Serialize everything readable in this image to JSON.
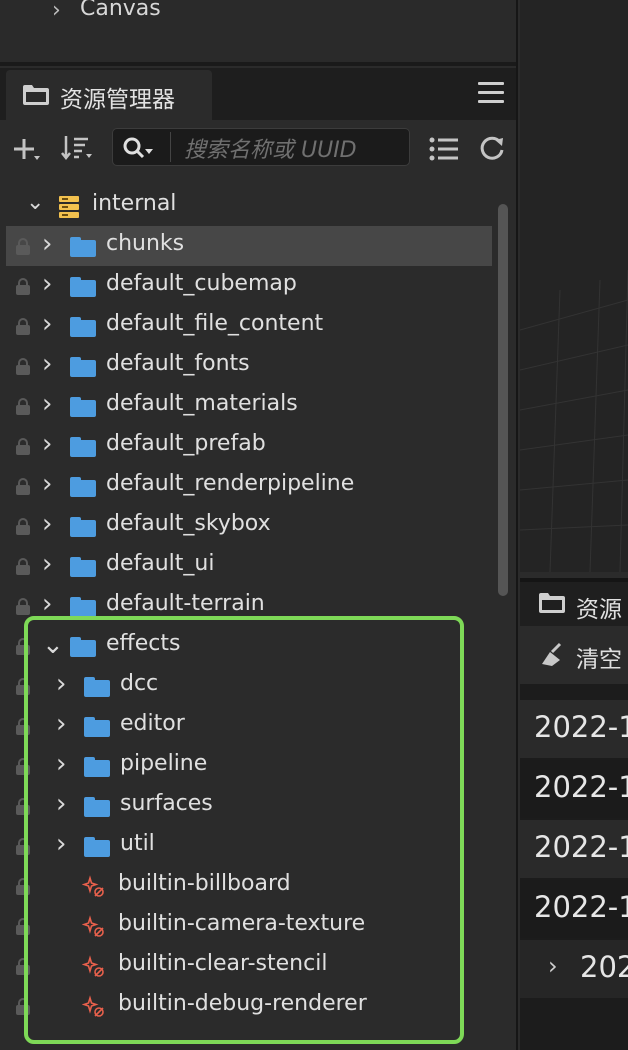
{
  "top_node": {
    "label": "Canvas"
  },
  "assets_panel": {
    "tab_label": "资源管理器",
    "search_placeholder": "搜索名称或 UUID"
  },
  "tree": {
    "root": {
      "label": "internal"
    },
    "items": [
      {
        "label": "chunks",
        "selected": true
      },
      {
        "label": "default_cubemap"
      },
      {
        "label": "default_file_content"
      },
      {
        "label": "default_fonts"
      },
      {
        "label": "default_materials"
      },
      {
        "label": "default_prefab"
      },
      {
        "label": "default_renderpipeline"
      },
      {
        "label": "default_skybox"
      },
      {
        "label": "default_ui"
      },
      {
        "label": "default-terrain"
      },
      {
        "label": "effects",
        "expanded": true
      }
    ],
    "effects_children": [
      {
        "label": "dcc",
        "type": "folder"
      },
      {
        "label": "editor",
        "type": "folder"
      },
      {
        "label": "pipeline",
        "type": "folder"
      },
      {
        "label": "surfaces",
        "type": "folder"
      },
      {
        "label": "util",
        "type": "folder"
      },
      {
        "label": "builtin-billboard",
        "type": "effect"
      },
      {
        "label": "builtin-camera-texture",
        "type": "effect"
      },
      {
        "label": "builtin-clear-stencil",
        "type": "effect"
      },
      {
        "label": "builtin-debug-renderer",
        "type": "effect"
      }
    ]
  },
  "console": {
    "tab_label": "资源",
    "clear_label": "清空",
    "logs": [
      "2022-1",
      "2022-1",
      "2022-1",
      "2022-1",
      "202"
    ]
  },
  "colors": {
    "folder": "#4d9ce0",
    "highlight": "#7ed957",
    "effect": "#e8604c"
  }
}
